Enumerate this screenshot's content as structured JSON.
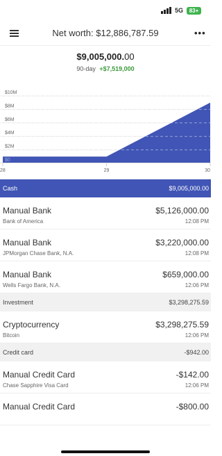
{
  "status_bar": {
    "time": "",
    "network": "5G",
    "battery": "83+"
  },
  "header": {
    "title": "Net worth: $12,886,787.59",
    "more": "•••"
  },
  "summary": {
    "total_main": "$9,005,000.",
    "total_cents": "00",
    "period": "90-day",
    "change": "+$7,519,000"
  },
  "chart_data": {
    "type": "area",
    "x": [
      "28",
      "29",
      "30"
    ],
    "values": [
      1000000,
      1000000,
      9005000
    ],
    "y_ticks": [
      "$0",
      "$2M",
      "$4M",
      "$6M",
      "$8M",
      "$10M"
    ],
    "ylim": [
      0,
      10000000
    ],
    "grid": true,
    "fill_color": "#4055b5"
  },
  "sections": [
    {
      "label": "Cash",
      "amount": "$9,005,000.00",
      "active": true
    },
    {
      "label": "Investment",
      "amount": "$3,298,275.59",
      "active": false
    },
    {
      "label": "Credit card",
      "amount": "-$942.00",
      "active": false
    }
  ],
  "accounts": {
    "cash": [
      {
        "name": "Manual Bank",
        "institution": "Bank of America",
        "balance": "$5,126,000.00",
        "time": "12:08 PM"
      },
      {
        "name": "Manual Bank",
        "institution": "JPMorgan Chase Bank, N.A.",
        "balance": "$3,220,000.00",
        "time": "12:08 PM"
      },
      {
        "name": "Manual Bank",
        "institution": "Wells Fargo Bank, N.A.",
        "balance": "$659,000.00",
        "time": "12:06 PM"
      }
    ],
    "investment": [
      {
        "name": "Cryptocurrency",
        "institution": "Bitcoin",
        "balance": "$3,298,275.59",
        "time": "12:06 PM"
      }
    ],
    "credit": [
      {
        "name": "Manual Credit Card",
        "institution": "Chase Sapphire Visa Card",
        "balance": "-$142.00",
        "time": "12:06 PM"
      },
      {
        "name": "Manual Credit Card",
        "institution": "",
        "balance": "-$800.00",
        "time": ""
      }
    ]
  },
  "colors": {
    "accent": "#4055b5",
    "positive": "#3a9a3a",
    "battery": "#3fb34f"
  }
}
